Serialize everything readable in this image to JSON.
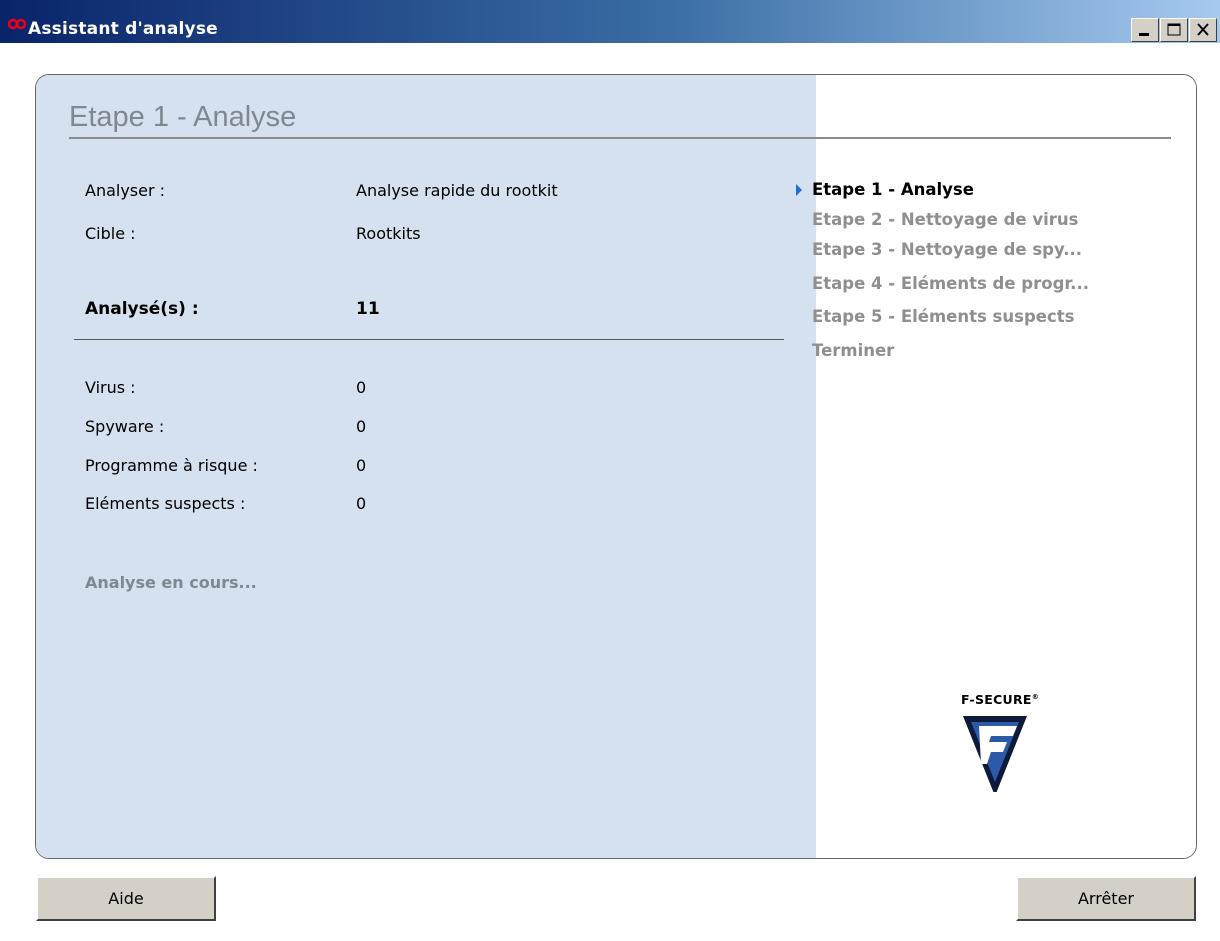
{
  "window": {
    "title": "Assistant d'analyse"
  },
  "left": {
    "title": "Etape 1 - Analyse",
    "rows_top": [
      {
        "label": "Analyser :",
        "value": "Analyse rapide du rootkit"
      },
      {
        "label": "Cible :",
        "value": "Rootkits"
      }
    ],
    "scanned": {
      "label": "Analysé(s) :",
      "value": "11"
    },
    "rows_counts": [
      {
        "label": "Virus :",
        "value": "0"
      },
      {
        "label": "Spyware :",
        "value": "0"
      },
      {
        "label": "Programme à risque :",
        "value": "0"
      },
      {
        "label": "Eléments suspects :",
        "value": "0"
      }
    ],
    "status": "Analyse en cours..."
  },
  "steps": [
    {
      "label": "Etape 1 - Analyse",
      "active": true
    },
    {
      "label": "Etape 2 - Nettoyage de virus",
      "active": false
    },
    {
      "label": "Etape 3 - Nettoyage de spy...",
      "active": false
    },
    {
      "label": "Etape 4 - Eléments de progr...",
      "active": false
    },
    {
      "label": "Etape 5 - Eléments suspects",
      "active": false
    },
    {
      "label": "Terminer",
      "active": false
    }
  ],
  "logo": {
    "text": "F-SECURE",
    "mark": "®"
  },
  "buttons": {
    "help": "Aide",
    "stop": "Arrêter"
  },
  "colors": {
    "left_panel": "#d6e1ef",
    "active_arrow": "#1a6ed6",
    "inactive_step": "#8f8f8f"
  },
  "icons": {
    "app": "f-secure-infinity-icon",
    "minimize": "minimize-icon",
    "maximize": "maximize-icon",
    "close": "close-icon",
    "logo": "f-secure-logo"
  }
}
